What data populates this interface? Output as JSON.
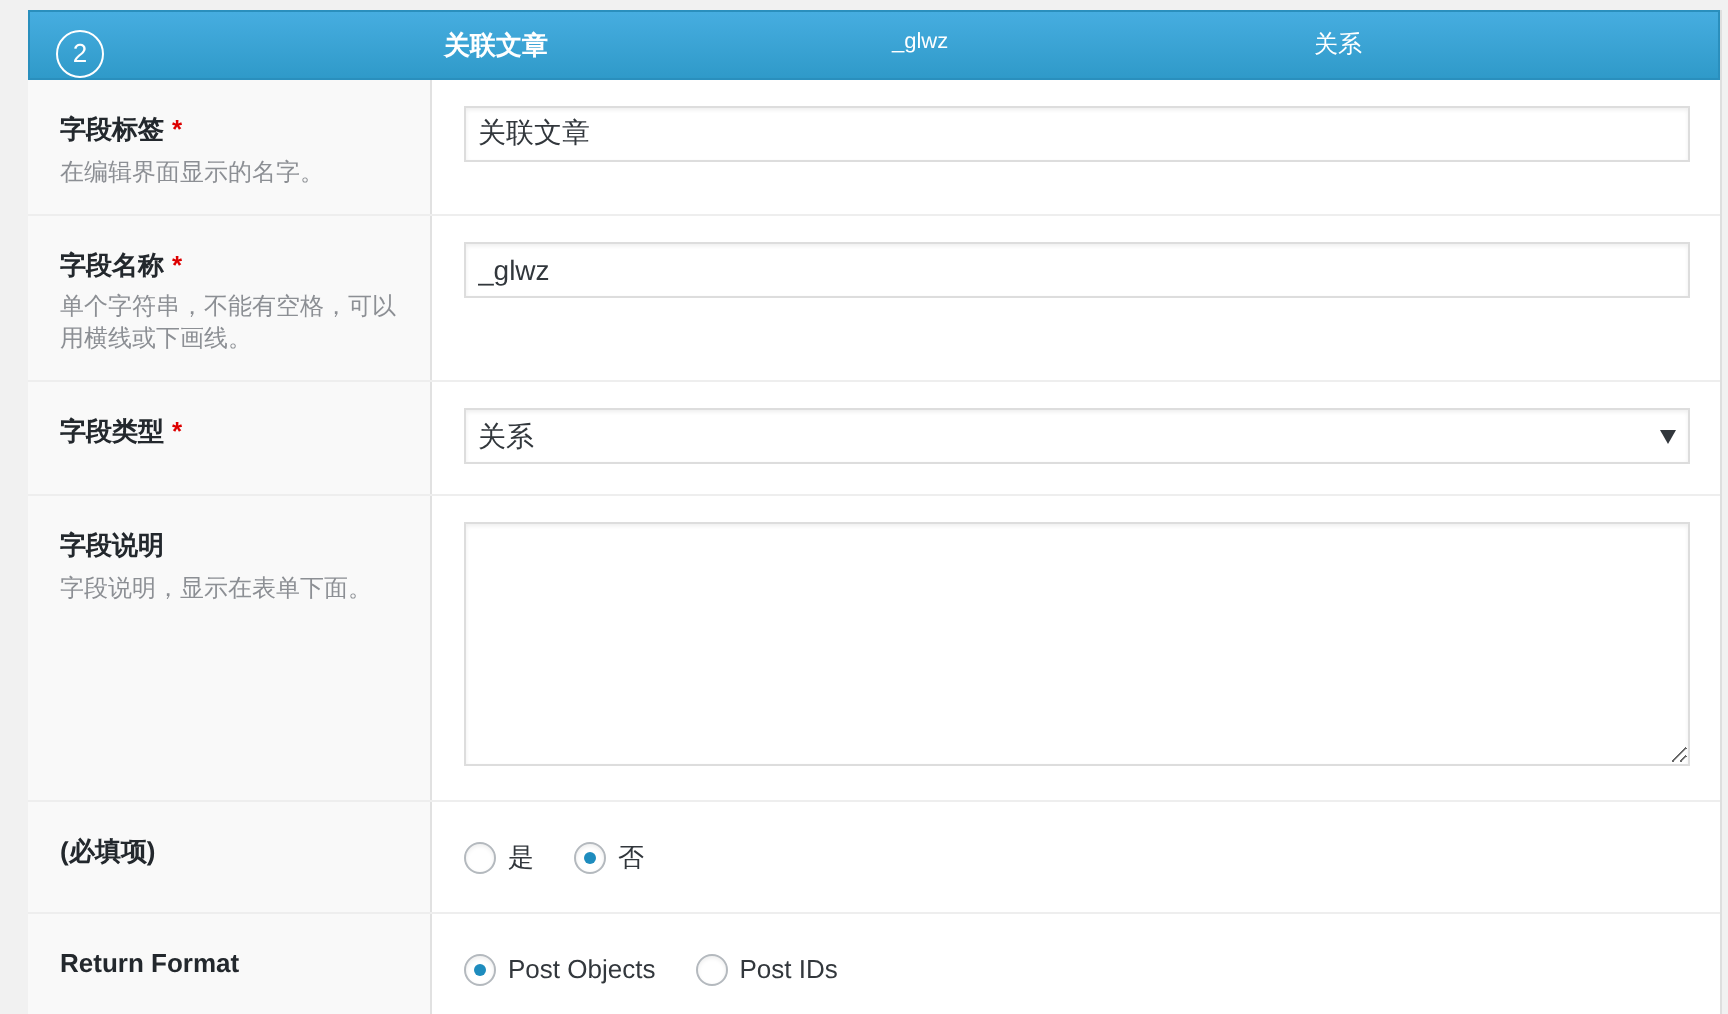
{
  "header": {
    "order": "2",
    "label": "关联文章",
    "name": "_glwz",
    "type": "关系"
  },
  "fields": [
    {
      "kind": "text",
      "label": "字段标签",
      "required": "*",
      "hint": "在编辑界面显示的名字。",
      "value": "关联文章"
    },
    {
      "kind": "text",
      "label": "字段名称",
      "required": "*",
      "hint": "单个字符串，不能有空格，可以用横线或下画线。",
      "value": "_glwz"
    },
    {
      "kind": "select",
      "label": "字段类型",
      "required": "*",
      "value": "关系"
    },
    {
      "kind": "textarea",
      "label": "字段说明",
      "hint": "字段说明，显示在表单下面。"
    },
    {
      "kind": "radio",
      "label": "(必填项)",
      "options": [
        {
          "label": "是",
          "selected": false
        },
        {
          "label": "否",
          "selected": true
        }
      ]
    },
    {
      "kind": "radio",
      "label": "Return Format",
      "options": [
        {
          "label": "Post Objects",
          "selected": true
        },
        {
          "label": "Post IDs",
          "selected": false
        }
      ]
    }
  ]
}
